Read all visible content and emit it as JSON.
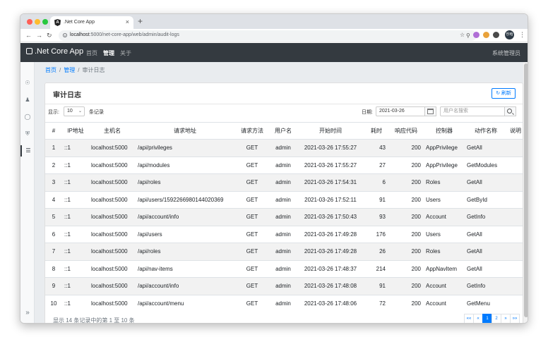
{
  "browser": {
    "tab_title": ".Net Core App",
    "favicon_letter": "A",
    "tab_close": "×",
    "new_tab": "+",
    "url_host": "localhost",
    "url_path": ":5000/net-core-app/web/admin/audit-logs",
    "avatar_text": "乐哈"
  },
  "navbar": {
    "brand": ".Net Core App",
    "items": [
      {
        "label": "首页"
      },
      {
        "label": "管理"
      },
      {
        "label": "关于"
      }
    ],
    "user": "系统管理员"
  },
  "breadcrumb": {
    "home": "首页",
    "admin": "管理",
    "current": "审计日志"
  },
  "card": {
    "title": "审计日志",
    "refresh_label": "刷新"
  },
  "filters": {
    "show_label": "显示:",
    "page_size": "10",
    "entries_label": "条记录",
    "date_label": "日期:",
    "date_value": "2021-03-26",
    "search_placeholder": "用户名搜索"
  },
  "table": {
    "columns": [
      "#",
      "IP地址",
      "主机名",
      "请求地址",
      "请求方法",
      "用户名",
      "开始时间",
      "耗时",
      "响应代码",
      "控制器",
      "动作名称",
      "说明"
    ],
    "rows": [
      [
        "1",
        "::1",
        "localhost:5000",
        "/api/privileges",
        "GET",
        "admin",
        "2021-03-26 17:55:27",
        "43",
        "200",
        "AppPrivilege",
        "GetAll",
        ""
      ],
      [
        "2",
        "::1",
        "localhost:5000",
        "/api/modules",
        "GET",
        "admin",
        "2021-03-26 17:55:27",
        "27",
        "200",
        "AppPrivilege",
        "GetModules",
        ""
      ],
      [
        "3",
        "::1",
        "localhost:5000",
        "/api/roles",
        "GET",
        "admin",
        "2021-03-26 17:54:31",
        "6",
        "200",
        "Roles",
        "GetAll",
        ""
      ],
      [
        "4",
        "::1",
        "localhost:5000",
        "/api/users/1592266980144020369",
        "GET",
        "admin",
        "2021-03-26 17:52:11",
        "91",
        "200",
        "Users",
        "GetById",
        ""
      ],
      [
        "5",
        "::1",
        "localhost:5000",
        "/api/account/info",
        "GET",
        "admin",
        "2021-03-26 17:50:43",
        "93",
        "200",
        "Account",
        "GetInfo",
        ""
      ],
      [
        "6",
        "::1",
        "localhost:5000",
        "/api/users",
        "GET",
        "admin",
        "2021-03-26 17:49:28",
        "176",
        "200",
        "Users",
        "GetAll",
        ""
      ],
      [
        "7",
        "::1",
        "localhost:5000",
        "/api/roles",
        "GET",
        "admin",
        "2021-03-26 17:49:28",
        "26",
        "200",
        "Roles",
        "GetAll",
        ""
      ],
      [
        "8",
        "::1",
        "localhost:5000",
        "/api/nav-items",
        "GET",
        "admin",
        "2021-03-26 17:48:37",
        "214",
        "200",
        "AppNavItem",
        "GetAll",
        ""
      ],
      [
        "9",
        "::1",
        "localhost:5000",
        "/api/account/info",
        "GET",
        "admin",
        "2021-03-26 17:48:08",
        "91",
        "200",
        "Account",
        "GetInfo",
        ""
      ],
      [
        "10",
        "::1",
        "localhost:5000",
        "/api/account/menu",
        "GET",
        "admin",
        "2021-03-26 17:48:06",
        "72",
        "200",
        "Account",
        "GetMenu",
        ""
      ]
    ]
  },
  "footer": {
    "summary": "显示 14 条记录中的第 1 至 10 条",
    "pager": [
      "««",
      "«",
      "1",
      "2",
      "»",
      "»»"
    ],
    "active_page": "1"
  },
  "colors": {
    "navbar": "#343a40",
    "primary": "#007bff",
    "success": "#28a745"
  }
}
